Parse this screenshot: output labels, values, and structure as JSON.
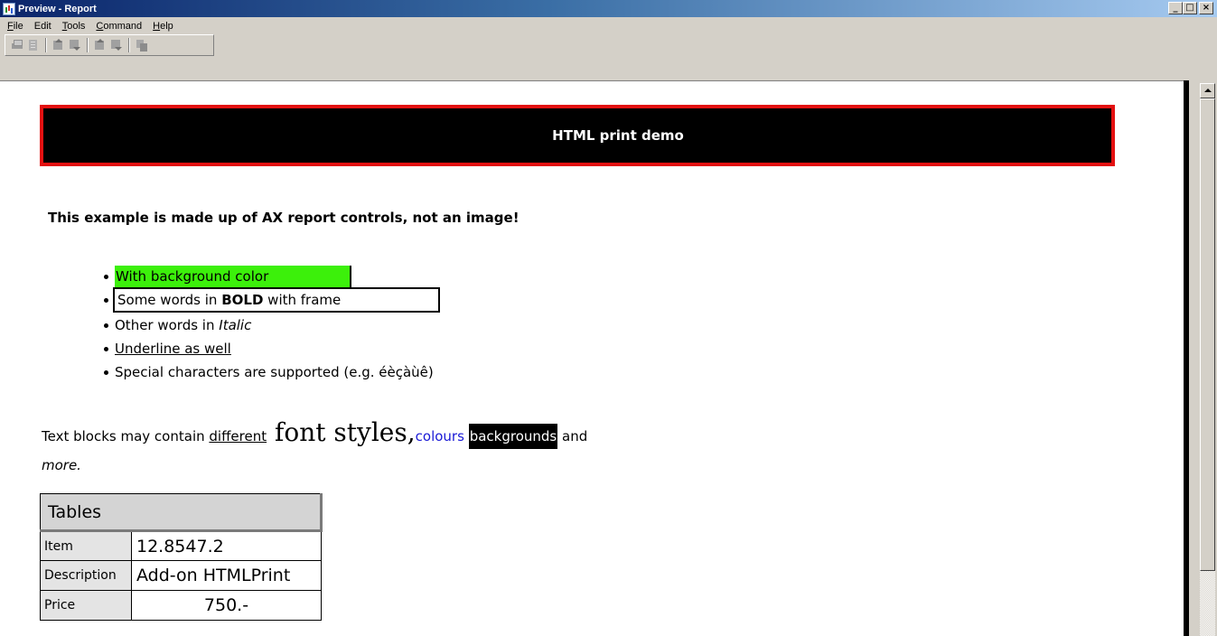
{
  "window": {
    "title": "Preview - Report",
    "minimize": "_",
    "maximize": "□",
    "close": "×"
  },
  "menu": {
    "items": [
      {
        "label": "File",
        "mnemonic": "F"
      },
      {
        "label": "Edit",
        "mnemonic": ""
      },
      {
        "label": "Tools",
        "mnemonic": "T"
      },
      {
        "label": "Command",
        "mnemonic": "C"
      },
      {
        "label": "Help",
        "mnemonic": "H"
      }
    ]
  },
  "toolbar": {
    "buttons": [
      "print-icon",
      "document-icon",
      "page-up-icon",
      "page-down-icon",
      "first-page-icon",
      "last-page-icon",
      "copy-icon"
    ]
  },
  "report": {
    "banner_title": "HTML print demo",
    "intro": "This example is made up of AX report controls, not an image!",
    "bullets": {
      "b1": "With background color",
      "b2_pre": "Some words in ",
      "b2_bold": "BOLD",
      "b2_post": " with frame",
      "b3_pre": "Other words in ",
      "b3_italic": "Italic",
      "b4": "Underline as well",
      "b5": "Special characters are supported (e.g. éèçàùê)"
    },
    "textblock": {
      "t1": "Text blocks may contain ",
      "t2": "different",
      "t3": " font styles,",
      "t4": "colours",
      "t5": "backgrounds",
      "t6": " and",
      "t7": "more."
    },
    "table": {
      "header": "Tables",
      "rows": [
        {
          "label": "Item",
          "value": "12.8547.2"
        },
        {
          "label": "Description",
          "value": "Add-on HTMLPrint"
        },
        {
          "label": "Price",
          "value": "750.-"
        }
      ]
    }
  },
  "colors": {
    "banner_bg": "#000000",
    "banner_border": "#e31010",
    "highlight_green": "#3cf00b",
    "link_blue": "#1a1ad6"
  }
}
